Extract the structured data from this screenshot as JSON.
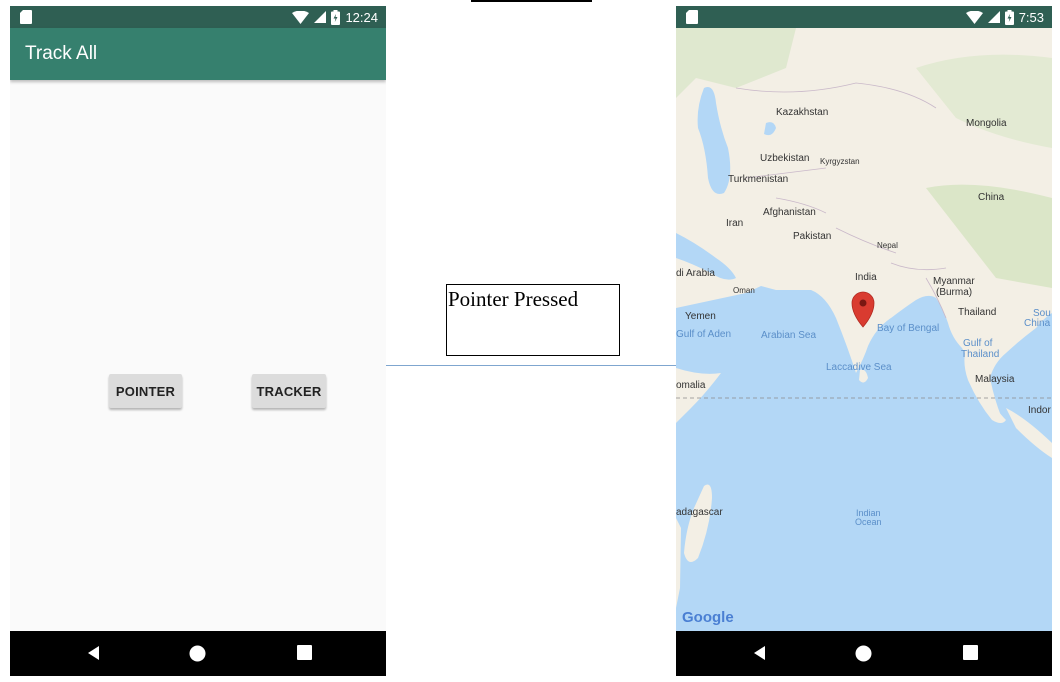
{
  "left_phone": {
    "status_time": "12:24",
    "app_title": "Track All",
    "pointer_button": "POINTER",
    "tracker_button": "TRACKER"
  },
  "annotation": {
    "caption": "Pointer Pressed"
  },
  "right_phone": {
    "status_time": "7:53",
    "map_labels": {
      "kazakhstan": "Kazakhstan",
      "mongolia": "Mongolia",
      "uzbekistan": "Uzbekistan",
      "kyrgyzstan": "Kyrgyzstan",
      "turkmenistan": "Turkmenistan",
      "china": "China",
      "afghanistan": "Afghanistan",
      "iran": "Iran",
      "pakistan": "Pakistan",
      "nepal": "Nepal",
      "saudi_arabia": "di Arabia",
      "india": "India",
      "myanmar": "Myanmar",
      "burma": "(Burma)",
      "oman": "Oman",
      "thailand": "Thailand",
      "south_china_1": "Sou",
      "south_china_2": "China",
      "yemen": "Yemen",
      "bay_of_bengal": "Bay of Bengal",
      "gulf_of_aden": "Gulf of Aden",
      "arabian_sea": "Arabian Sea",
      "gulf_of_thailand_1": "Gulf of",
      "gulf_of_thailand_2": "Thailand",
      "laccadive_sea": "Laccadive Sea",
      "somalia": "omalia",
      "malaysia": "Malaysia",
      "indonesia": "Indor",
      "madagascar": "adagascar",
      "indian_ocean_1": "Indian",
      "indian_ocean_2": "Ocean",
      "google": "Google"
    }
  },
  "colors": {
    "status_bar": "#2f5f53",
    "app_bar": "#36806e",
    "ocean": "#b3d7f6",
    "land": "#f3efe5",
    "marker": "#d93b30"
  },
  "icons": [
    "sd-card-icon",
    "wifi-icon",
    "signal-icon",
    "battery-icon",
    "back-icon",
    "home-icon",
    "recents-icon",
    "map-marker-icon"
  ]
}
